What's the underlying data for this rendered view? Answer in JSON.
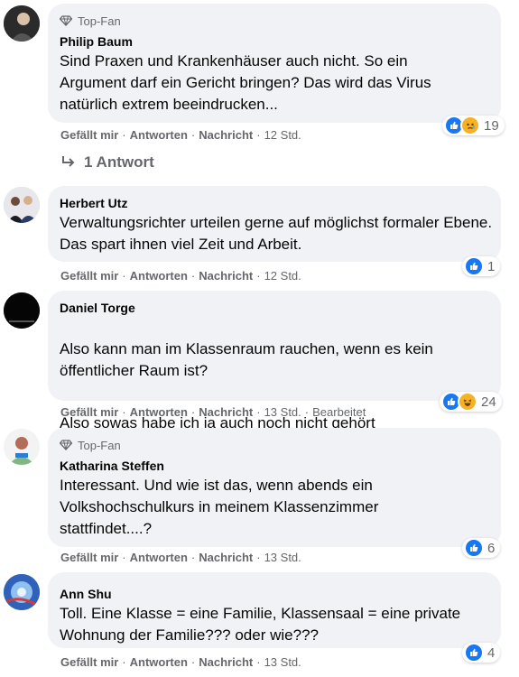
{
  "actions": {
    "like": "Gefällt mir",
    "reply": "Antworten",
    "message": "Nachricht",
    "dot": "·"
  },
  "comments": [
    {
      "badge": "Top-Fan",
      "author": "Philip Baum",
      "text": "Sind Praxen und Krankenhäuser auch nicht. So ein Argument darf ein Gericht bringen? Das wird das Virus natürlich extrem beeindrucken...",
      "time": "12 Std.",
      "reactions": {
        "icons": [
          "like-icon",
          "sad-icon"
        ],
        "count": "19"
      }
    },
    {
      "author": "Herbert Utz",
      "text": "Verwaltungsrichter urteilen gerne auf möglichst formaler Ebene. Das spart ihnen viel Zeit und Arbeit.",
      "time": "12 Std.",
      "reactions": {
        "icons": [
          "like-icon"
        ],
        "count": "1"
      }
    },
    {
      "author": "Daniel Torge",
      "text": "Also kann man im Klassenraum rauchen, wenn es kein öffentlicher Raum ist?",
      "text2": "Also sowas habe ich ja auch noch nicht gehört",
      "time": "13 Std.",
      "edited": "Bearbeitet",
      "reactions": {
        "icons": [
          "like-icon",
          "haha-icon"
        ],
        "count": "24"
      }
    },
    {
      "badge": "Top-Fan",
      "author": "Katharina Steffen",
      "text": "Interessant. Und wie ist das, wenn abends ein Volkshochschulkurs in meinem Klassenzimmer stattfindet....?",
      "time": "13 Std.",
      "reactions": {
        "icons": [
          "like-icon"
        ],
        "count": "6"
      }
    },
    {
      "author": "Ann Shu",
      "text": "Toll. Eine Klasse = eine Familie, Klassensaal = eine private Wohnung der Familie??? oder wie???",
      "time": "13 Std.",
      "reactions": {
        "icons": [
          "like-icon"
        ],
        "count": "4"
      }
    }
  ],
  "replies_link": "1 Antwort",
  "colors": {
    "like": "#1877f2",
    "bubble": "#f0f2f5",
    "secondary": "#65676b"
  }
}
